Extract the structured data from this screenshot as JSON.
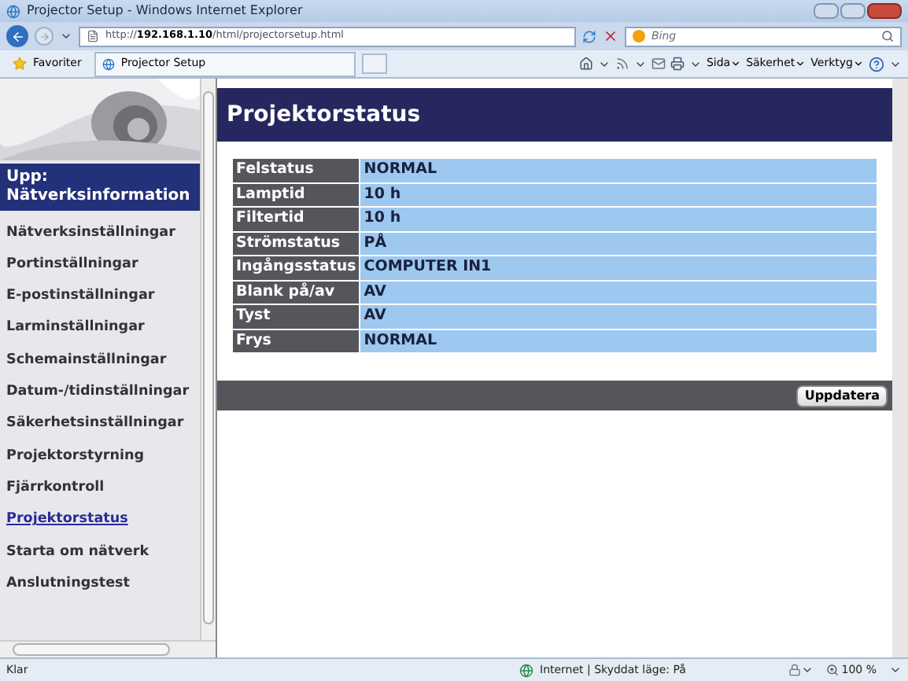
{
  "window": {
    "title": "Projector Setup - Windows Internet Explorer"
  },
  "address_bar": {
    "url_prefix": "http://",
    "url_host": "192.168.1.10",
    "url_path": "/html/projectorsetup.html",
    "search_placeholder": "Bing"
  },
  "favorites_bar": {
    "favorites": "Favoriter",
    "tab": "Projector Setup",
    "menus": [
      "Sida",
      "Säkerhet",
      "Verktyg"
    ]
  },
  "sidebar": {
    "header": "Upp: Nätverksinformation",
    "items": [
      {
        "label": "Nätverksinställningar",
        "selected": false
      },
      {
        "label": "Portinställningar",
        "selected": false
      },
      {
        "label": "E-postinställningar",
        "selected": false
      },
      {
        "label": "Larminställningar",
        "selected": false
      },
      {
        "label": "Schemainställningar",
        "selected": false
      },
      {
        "label": "Datum-/tidinställningar",
        "selected": false
      },
      {
        "label": "Säkerhetsinställningar",
        "selected": false
      },
      {
        "label": "Projektorstyrning",
        "selected": false
      },
      {
        "label": "Fjärrkontroll",
        "selected": false
      },
      {
        "label": "Projektorstatus",
        "selected": true
      },
      {
        "label": "Starta om nätverk",
        "selected": false
      },
      {
        "label": "Anslutningstest",
        "selected": false
      }
    ]
  },
  "main": {
    "heading": "Projektorstatus",
    "rows": [
      {
        "label": "Felstatus",
        "value": "NORMAL"
      },
      {
        "label": "Lamptid",
        "value": "10 h"
      },
      {
        "label": "Filtertid",
        "value": "10 h"
      },
      {
        "label": "Strömstatus",
        "value": "PÅ"
      },
      {
        "label": "Ingångsstatus",
        "value": "COMPUTER IN1"
      },
      {
        "label": "Blank på/av",
        "value": "AV"
      },
      {
        "label": "Tyst",
        "value": "AV"
      },
      {
        "label": "Frys",
        "value": "NORMAL"
      }
    ],
    "button": "Uppdatera"
  },
  "status_bar": {
    "status": "Klar",
    "zone": "Internet | Skyddat läge: På",
    "zoom": "100 %"
  }
}
